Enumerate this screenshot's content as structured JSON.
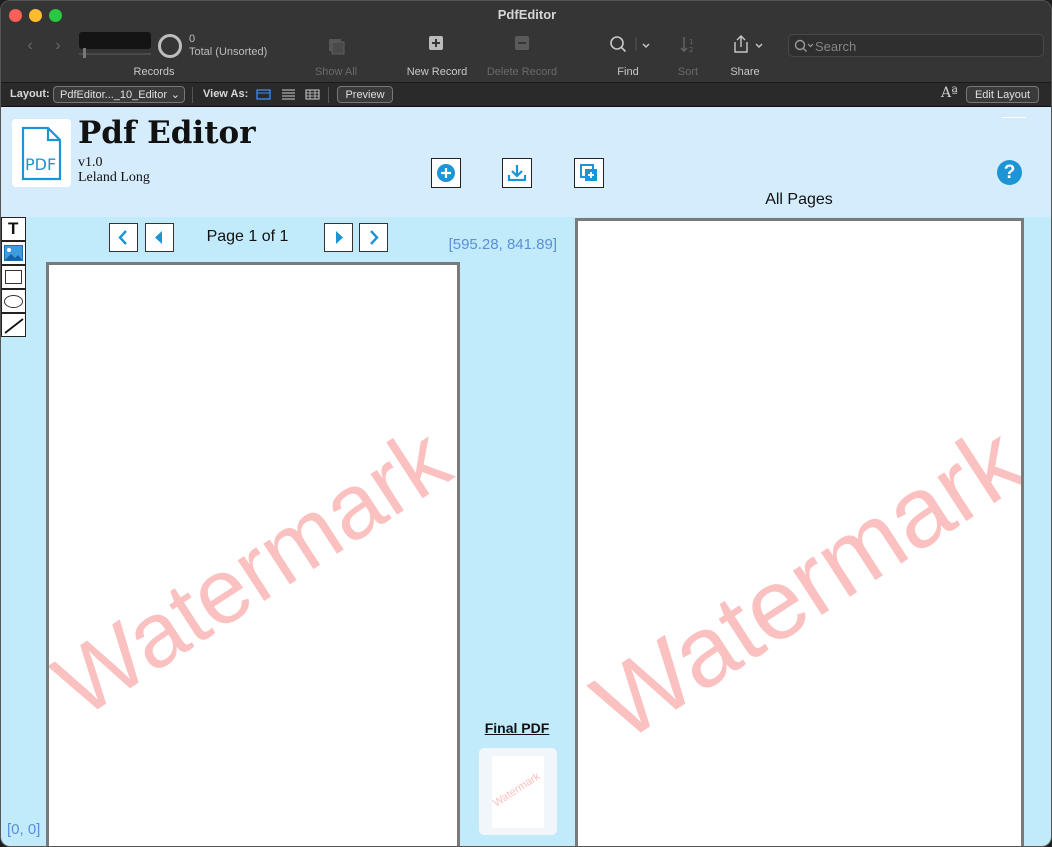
{
  "window": {
    "title": "PdfEditor"
  },
  "toolbar": {
    "records_count": "0",
    "records_total": "Total (Unsorted)",
    "records_label": "Records",
    "show_all": "Show All",
    "new_record": "New Record",
    "delete_record": "Delete Record",
    "find": "Find",
    "sort": "Sort",
    "share": "Share",
    "search_placeholder": "Search"
  },
  "layoutbar": {
    "layout_label": "Layout:",
    "layout_value": "PdfEditor..._10_Editor",
    "view_as_label": "View As:",
    "preview_button": "Preview",
    "edit_layout_button": "Edit Layout",
    "font_icon_text": "Aª"
  },
  "header": {
    "logo_text": "PDF",
    "title": "Pdf Editor",
    "version": "v1.0",
    "author": "Leland Long",
    "all_pages": "All Pages",
    "help": "?"
  },
  "editor": {
    "page_label": "Page 1 of 1",
    "page_size": "[595.28, 841.89]",
    "origin": "[0, 0]",
    "watermark": "Watermark",
    "final_pdf_label": "Final PDF"
  },
  "colors": {
    "accent": "#1b95d6",
    "background": "#c1eafb",
    "header_band": "#d5ecfd",
    "coords": "#5b8fd8",
    "watermark": "#f88c8c"
  }
}
